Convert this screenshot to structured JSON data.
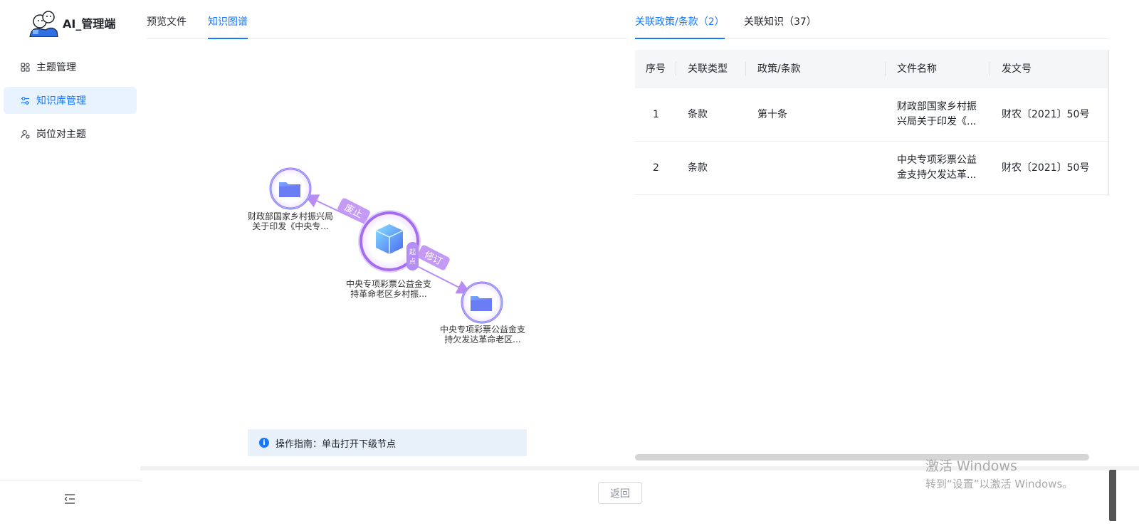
{
  "app": {
    "title": "AI_管理端"
  },
  "sidebar": {
    "items": [
      {
        "label": "主题管理",
        "icon": "grid-icon"
      },
      {
        "label": "知识库管理",
        "icon": "sliders-icon"
      },
      {
        "label": "岗位对主题",
        "icon": "user-settings-icon"
      }
    ],
    "active_index": 1
  },
  "left_tabs": [
    {
      "label": "预览文件"
    },
    {
      "label": "知识图谱"
    }
  ],
  "left_active_tab": 1,
  "graph": {
    "center": {
      "label_line1": "中央专项彩票公益金支",
      "label_line2": "持革命老区乡村振...",
      "badge_line1": "起",
      "badge_line2": "点"
    },
    "node_top_left": {
      "label_line1": "财政部国家乡村振兴局",
      "label_line2": "关于印发《中央专..."
    },
    "node_bottom_right": {
      "label_line1": "中央专项彩票公益金支",
      "label_line2": "持欠发达革命老区..."
    },
    "edge_top": {
      "label": "废止"
    },
    "edge_bottom": {
      "label": "修订"
    },
    "colors": {
      "edge": "#b98bf5",
      "edge_label_bg": "#c49af5",
      "node_ring": "#a66cf0"
    }
  },
  "guide": {
    "text": "操作指南：单击打开下级节点",
    "icon": "info-icon"
  },
  "right_tabs": [
    {
      "label": "关联政策/条款（2）"
    },
    {
      "label": "关联知识（37）"
    }
  ],
  "right_active_tab": 0,
  "table": {
    "headers": [
      "序号",
      "关联类型",
      "政策/条款",
      "文件名称",
      "发文号"
    ],
    "rows": [
      {
        "no": "1",
        "type": "条款",
        "clause": "第十条",
        "file_line1": "财政部国家乡村振",
        "file_line2": "兴局关于印发《...",
        "doc_no": "财农〔2021〕50号"
      },
      {
        "no": "2",
        "type": "条款",
        "clause": "",
        "file_line1": "中央专项彩票公益",
        "file_line2": "金支持欠发达革...",
        "doc_no": "财农〔2021〕50号"
      }
    ]
  },
  "footer": {
    "back_label": "返回"
  },
  "watermark": {
    "line1": "激活 Windows",
    "line2": "转到“设置”以激活 Windows。"
  },
  "theme": {
    "primary": "#1677ff",
    "active_bg": "#e8f3ff"
  }
}
